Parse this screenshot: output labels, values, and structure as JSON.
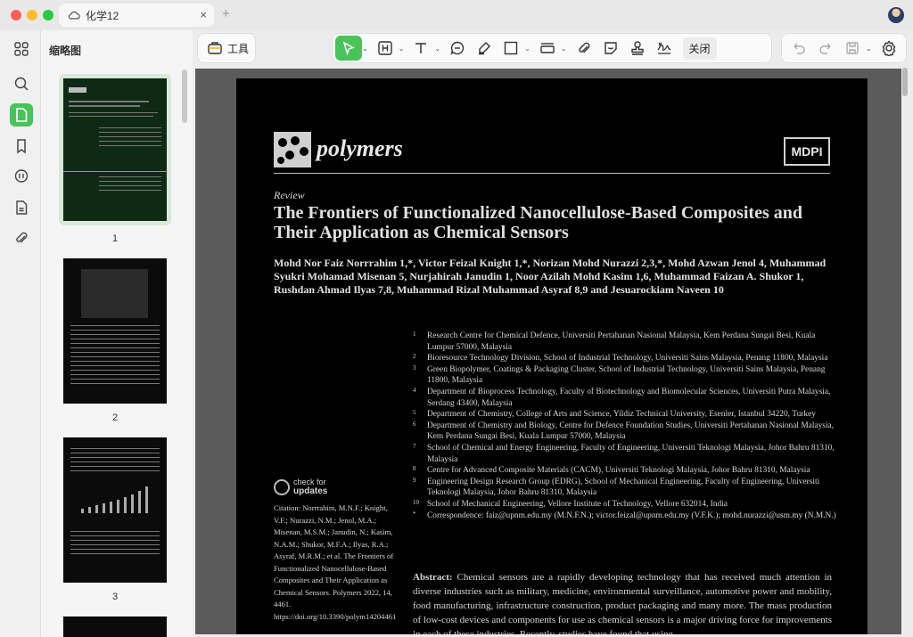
{
  "window": {
    "tab_title": "化学12",
    "tab_close": "×",
    "new_tab": "+"
  },
  "rail": {
    "items": [
      "grid-icon",
      "search-icon",
      "page-icon",
      "bookmark-icon",
      "comment-icon",
      "document-icon",
      "attachment-icon"
    ],
    "active": "page-icon"
  },
  "thumbnails": {
    "title": "缩略图",
    "pages": [
      "1",
      "2",
      "3"
    ]
  },
  "toolbar": {
    "tools_label": "工具",
    "close_label": "关闭",
    "accent": "#49c35a"
  },
  "paper": {
    "journal": "polymers",
    "publisher": "MDPI",
    "article_type": "Review",
    "title": "The Frontiers of Functionalized Nanocellulose-Based Composites and Their Application as Chemical Sensors",
    "authors": "Mohd Nor Faiz Norrrahim 1,*, Victor Feizal Knight 1,*, Norizan Mohd Nurazzi 2,3,*, Mohd Azwan Jenol 4, Muhammad Syukri Mohamad Misenan 5, Nurjahirah Janudin 1, Noor Azilah Mohd Kasim 1,6, Muhammad Faizan A. Shukor 1, Rushdan Ahmad Ilyas 7,8, Muhammad Rizal Muhammad Asyraf 8,9 and Jesuarockiam Naveen 10",
    "affiliations": [
      {
        "n": "1",
        "text": "Research Centre for Chemical Defence, Universiti Pertahanan Nasional Malaysia, Kem Perdana Sungai Besi, Kuala Lumpur 57000, Malaysia"
      },
      {
        "n": "2",
        "text": "Bioresource Technology Division, School of Industrial Technology, Universiti Sains Malaysia, Penang 11800, Malaysia"
      },
      {
        "n": "3",
        "text": "Green Biopolymer, Coatings & Packaging Cluster, School of Industrial Technology, Universiti Sains Malaysia, Penang 11800, Malaysia"
      },
      {
        "n": "4",
        "text": "Department of Bioprocess Technology, Faculty of Biotechnology and Biomolecular Sciences, Universiti Putra Malaysia, Serdang 43400, Malaysia"
      },
      {
        "n": "5",
        "text": "Department of Chemistry, College of Arts and Science, Yildiz Technical University, Esenler, Istanbul 34220, Turkey"
      },
      {
        "n": "6",
        "text": "Department of Chemistry and Biology, Centre for Defence Foundation Studies, Universiti Pertahanan Nasional Malaysia, Kem Perdana Sungai Besi, Kuala Lumpur 57000, Malaysia"
      },
      {
        "n": "7",
        "text": "School of Chemical and Energy Engineering, Faculty of Engineering, Universiti Teknologi Malaysia, Johor Bahru 81310, Malaysia"
      },
      {
        "n": "8",
        "text": "Centre for Advanced Composite Materials (CACM), Universiti Teknologi Malaysia, Johor Bahru 81310, Malaysia"
      },
      {
        "n": "9",
        "text": "Engineering Design Research Group (EDRG), School of Mechanical Engineering, Faculty of Engineering, Universiti Teknologi Malaysia, Johor Bahru 81310, Malaysia"
      },
      {
        "n": "10",
        "text": "School of Mechanical Engineering, Vellore Institute of Technology, Vellore 632014, India"
      },
      {
        "n": "*",
        "text": "Correspondence: faiz@upnm.edu.my (M.N.F.N.); victor.feizal@upnm.edu.my (V.F.K.); mohd.nurazzi@usm.my (N.M.N.)"
      }
    ],
    "check_for": "check for",
    "updates": "updates",
    "citation": "Citation: Norrrahim, M.N.F.; Knight, V.F.; Nurazzi, N.M.; Jenol, M.A.; Misenan, M.S.M.; Janudin, N.; Kasim, N.A.M.; Shukor, M.F.A.; Ilyas, R.A.; Asyraf, M.R.M.; et al. The Frontiers of Functionalized Nanocellulose-Based Composites and Their Application as Chemical Sensors. Polymers 2022, 14, 4461. https://doi.org/10.3390/polym14204461",
    "abstract_label": "Abstract:",
    "abstract": "Chemical sensors are a rapidly developing technology that has received much attention in diverse industries such as military, medicine, environmental surveillance, automotive power and mobility, food manufacturing, infrastructure construction, product packaging and many more. The mass production of low-cost devices and components for use as chemical sensors is a major driving force for improvements in each of these industries. Recently, studies have found that using"
  }
}
